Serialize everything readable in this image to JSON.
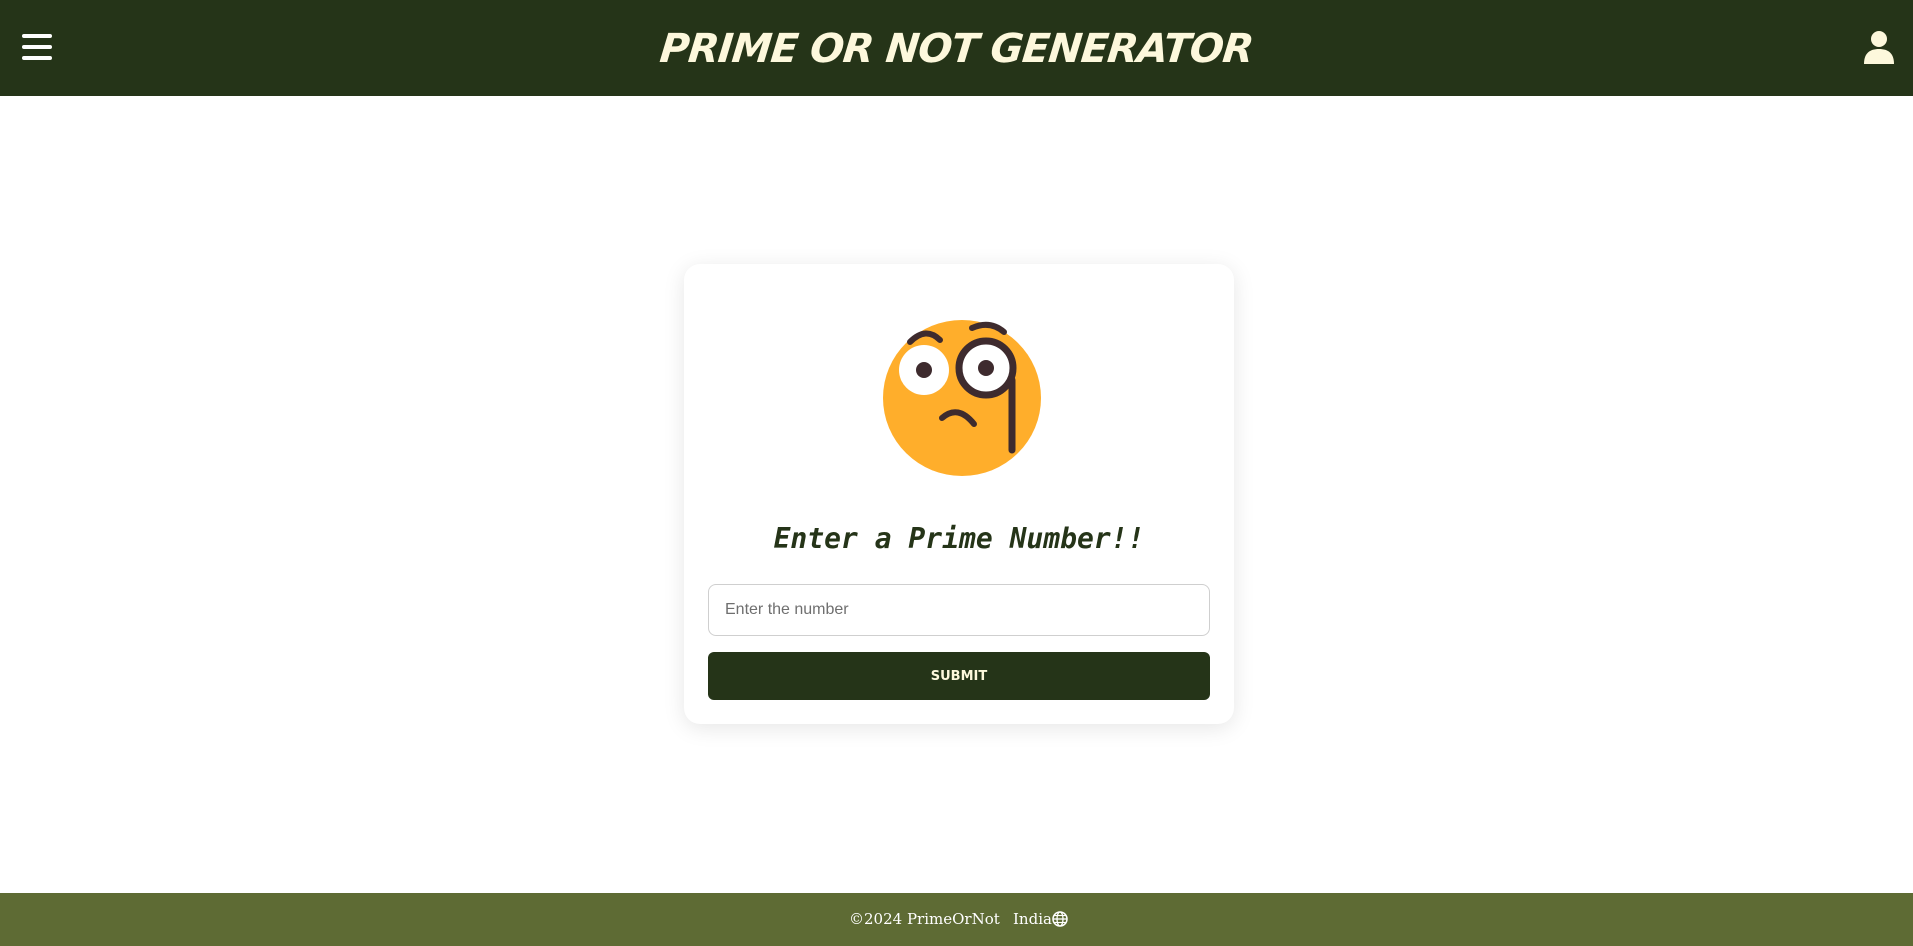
{
  "header": {
    "title": "PRIME OR NOT GENERATOR",
    "menu_icon": "hamburger-menu-icon",
    "user_icon": "user-icon",
    "background": "#253418",
    "text_color": "#fdf8dc"
  },
  "main": {
    "emoji_icon": "face-with-monocle-icon",
    "heading": "Enter a Prime Number!!",
    "input": {
      "value": "",
      "placeholder": "Enter the number"
    },
    "submit_label": "SUBMIT",
    "accent": "#253418"
  },
  "footer": {
    "copyright": "©2024 PrimeOrNot",
    "region": "India",
    "region_icon": "globe-icon",
    "background": "#5e6b34"
  }
}
